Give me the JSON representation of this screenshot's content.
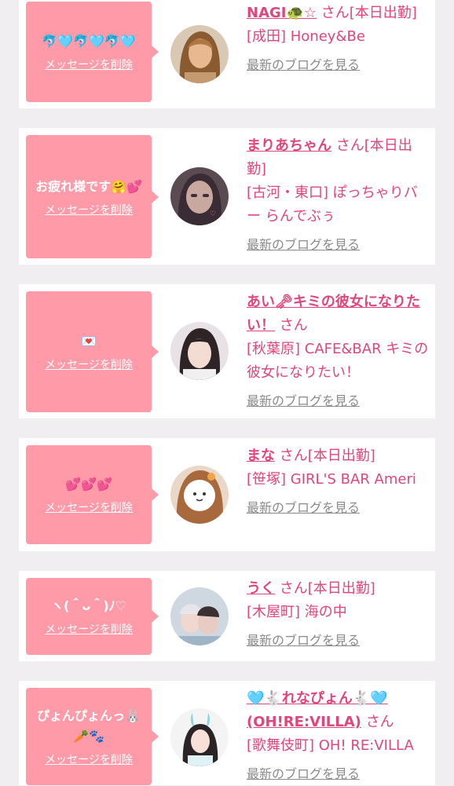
{
  "delete_label": "メッセージを削除",
  "blog_label": "最新のブログを見る",
  "colors": {
    "bubble": "#ff9aa8",
    "accent": "#e0457b",
    "link_gray": "#8a8a8a",
    "card_bg": "#ffffff",
    "page_bg": "#f0eef0"
  },
  "messages": [
    {
      "message": "🐬🩵🐬🩵🐬🩵",
      "name": "NAGI🐢☆",
      "status": "さん[本日出勤]",
      "shop": "[成田] Honey&Be",
      "avatar_icon": "avatar-woman-blonde"
    },
    {
      "message": "お疲れ様です🤗💕",
      "name": "まりあちゃん",
      "status": "さん[本日出勤]",
      "shop": "[古河・東口] ぽっちゃりバー らんでぶぅ",
      "avatar_icon": "avatar-woman-stamp"
    },
    {
      "message": "💌",
      "name": "あい🗝キミの彼女になりたい！",
      "status": "さん",
      "shop": "[秋葉原] CAFE&BAR キミの彼女になりたい！",
      "avatar_icon": "avatar-woman-bangs"
    },
    {
      "message": "💕💕💕",
      "name": "まな",
      "status": "さん[本日出勤]",
      "shop": "[笹塚] GIRL'S BAR Ameri",
      "avatar_icon": "avatar-face-sticker"
    },
    {
      "message": "ヽ(＾ᴗ＾)ﾉ♡",
      "name": "うく",
      "status": "さん[本日出勤]",
      "shop": "[木屋町] 海の中",
      "avatar_icon": "avatar-woman-duo"
    },
    {
      "message": "ぴょんぴょんっ🐰🥕🐾",
      "name": "🩵🐇れなぴょん🐇🩵(OH!RE:VILLA)",
      "status": "さん",
      "shop": "[歌舞伎町] OH! RE:VILLA",
      "avatar_icon": "avatar-woman-bunny"
    }
  ]
}
